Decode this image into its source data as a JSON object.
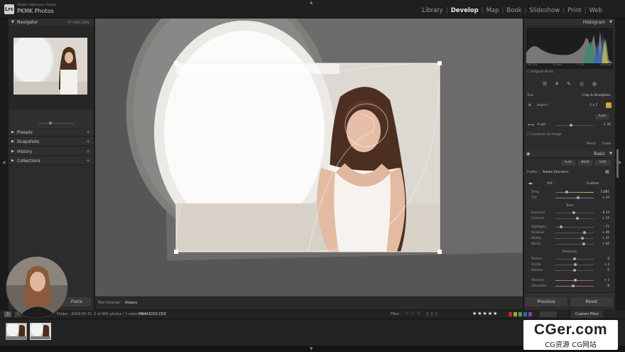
{
  "app": {
    "subtitle": "Adobe Lightroom Classic",
    "title": "PKMK Photos",
    "logo": "Lrc"
  },
  "modules": [
    "Library",
    "Develop",
    "Map",
    "Book",
    "Slideshow",
    "Print",
    "Web"
  ],
  "active_module": "Develop",
  "left": {
    "navigator": "Navigator",
    "nav_zoom": "FIT  100%  200%",
    "presets": "Presets",
    "snapshots": "Snapshots",
    "history": "History",
    "collections": "Collections",
    "paste": "Paste"
  },
  "toolbar": {
    "label": "Tool Overlay :",
    "value": "Always"
  },
  "right": {
    "histogram": "Histogram",
    "hist_meta": [
      "ISO 100",
      "35 mm",
      "f / 2.8",
      "1/160 sec"
    ],
    "original_photo": "Original Photo",
    "tool_label": "Tool",
    "crop_label": "Crop & Straighten",
    "aspect_label": "Aspect :",
    "aspect_value": "5 x 7",
    "auto": "Auto",
    "angle_label": "Angle",
    "angle_value": "-1.34",
    "constrain": "Constrain to Image",
    "reset": "Reset",
    "close": "Close",
    "basic": "Basic",
    "treat_auto": "Auto",
    "treat_bw": "B&W",
    "treat_hdr": "HDR",
    "profile_label": "Profile :",
    "profile_value": "Adobe Standard",
    "wb_label": "WB :",
    "wb_value": "Custom",
    "temp": {
      "label": "Temp",
      "value": "5,885"
    },
    "tint": {
      "label": "Tint",
      "value": "+ 20"
    },
    "tone": "Tone",
    "exposure": {
      "label": "Exposure",
      "value": "- 0.10"
    },
    "contrast": {
      "label": "Contrast",
      "value": "+ 15"
    },
    "highlights": {
      "label": "Highlights",
      "value": "- 71"
    },
    "shadows": {
      "label": "Shadows",
      "value": "+ 49"
    },
    "whites": {
      "label": "Whites",
      "value": "+ 37"
    },
    "blacks": {
      "label": "Blacks",
      "value": "+ 42"
    },
    "presence": "Presence",
    "texture": {
      "label": "Texture",
      "value": "0"
    },
    "clarity": {
      "label": "Clarity",
      "value": "+ 3"
    },
    "dehaze": {
      "label": "Dehaze",
      "value": "0"
    },
    "vibrance": {
      "label": "Vibrance",
      "value": "+ 3"
    },
    "saturation": {
      "label": "Saturation",
      "value": "- 8"
    },
    "previous": "Previous",
    "reset_btn": "Reset"
  },
  "filmbar": {
    "page1": "1",
    "page2": "2",
    "path": "Folder : 2024-05-31",
    "count": "2 of 465 photos / 1 selected /",
    "filename": "FN4A3202.CR3",
    "filter": "Filter :",
    "stars": "★★★★★",
    "custom_filter": "Custom Filter"
  },
  "film_stars": [
    "★★★★★",
    "★★★★★"
  ],
  "watermark": {
    "line1": "CGer.com",
    "line2": "CG资源 CG网站"
  }
}
